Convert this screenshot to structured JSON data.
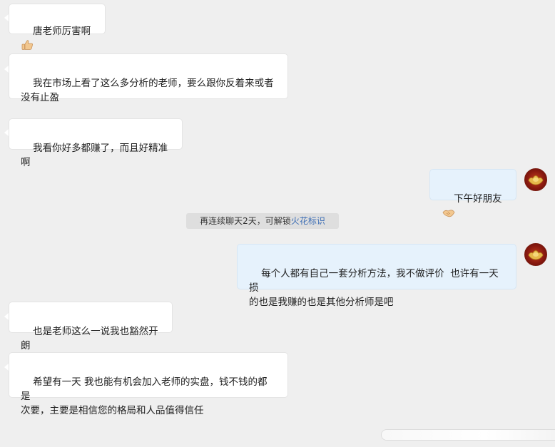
{
  "messages": [
    {
      "side": "left",
      "text": "唐老师厉害啊",
      "emoji": "thumbs-up"
    },
    {
      "side": "left",
      "text": "我在市场上看了这么多分析的老师，要么跟你反着来或者\n没有止盈"
    },
    {
      "side": "left",
      "text": "我看你好多都赚了，而且好精准啊"
    },
    {
      "side": "right",
      "text": "下午好朋友",
      "emoji": "handshake"
    },
    {
      "side": "right",
      "text": "每个人都有自己一套分析方法，我不做评价  也许有一天损\n的也是我赚的也是其他分析师是吧"
    },
    {
      "side": "left",
      "text": "也是老师这么一说我也豁然开朗"
    },
    {
      "side": "left",
      "text": "希望有一天 我也能有机会加入老师的实盘，钱不钱的都是\n次要，主要是相信您的格局和人品值得信任"
    }
  ],
  "system_tip": {
    "prefix": "再连续聊天2天，可解锁",
    "link": "火花标识"
  },
  "colors": {
    "background": "#efefef",
    "left_bubble": "#ffffff",
    "right_bubble": "#e6f2fc",
    "link": "#3d6eb5"
  }
}
